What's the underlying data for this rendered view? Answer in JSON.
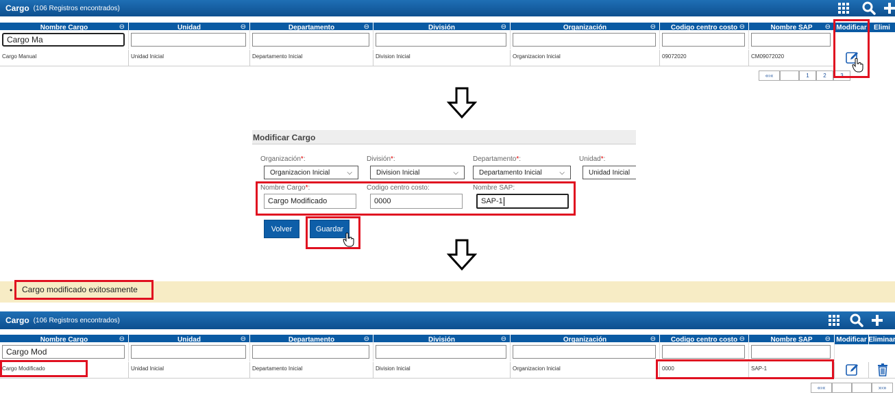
{
  "top_grid": {
    "title": "Cargo",
    "count": "(106 Registros encontrados)",
    "columns": [
      "Nombre Cargo",
      "Unidad",
      "Departamento",
      "División",
      "Organización",
      "Codigo centro costo",
      "Nombre SAP",
      "Modificar",
      "Elimi"
    ],
    "filter_value": "Cargo Ma",
    "row": [
      "Cargo Manual",
      "Unidad Inicial",
      "Departamento Inicial",
      "Division Inicial",
      "Organizacion Inicial",
      "09072020",
      "CM09072020"
    ],
    "pagination": [
      "«‹«",
      "",
      "1",
      "2",
      "3"
    ]
  },
  "form": {
    "title": "Modificar Cargo",
    "organizacion_label": "Organización",
    "division_label": "División",
    "departamento_label": "Departamento",
    "unidad_label": "Unidad",
    "required_mark": "*",
    "colon": ":",
    "organizacion_value": "Organizacion Inicial",
    "division_value": "Division Inicial",
    "departamento_value": "Departamento Inicial",
    "unidad_value": "Unidad Inicial",
    "nombre_cargo_label": "Nombre Cargo",
    "codigo_label": "Codigo centro costo:",
    "sap_label": "Nombre SAP:",
    "nombre_cargo_value": "Cargo Modificado",
    "codigo_value": "0000",
    "sap_value": "SAP-1",
    "back_button": "Volver",
    "save_button": "Guardar"
  },
  "message": {
    "bullet": "•",
    "text": "Cargo modificado exitosamente"
  },
  "bottom_grid": {
    "title": "Cargo",
    "count": "(106 Registros encontrados)",
    "columns": [
      "Nombre Cargo",
      "Unidad",
      "Departamento",
      "División",
      "Organización",
      "Codigo centro costo",
      "Nombre SAP",
      "Modificar",
      "Eliminar"
    ],
    "filter_value": "Cargo Mod",
    "row": [
      "Cargo Modificado",
      "Unidad Inicial",
      "Departamento Inicial",
      "Division Inicial",
      "Organizacion Inicial",
      "0000",
      "SAP-1"
    ],
    "pagination": [
      "«‹«",
      "",
      "",
      "»›»"
    ]
  },
  "icons": {
    "grid": "grid-icon",
    "search": "search-icon",
    "add": "plus-icon",
    "edit": "pencil-icon",
    "delete": "trash-icon",
    "arrow": "down-arrow-icon",
    "sort": "sort-icon"
  },
  "colors": {
    "header_blue": "#0a5aa3",
    "highlight_red": "#e01020",
    "message_bg": "#f7ecc5"
  }
}
